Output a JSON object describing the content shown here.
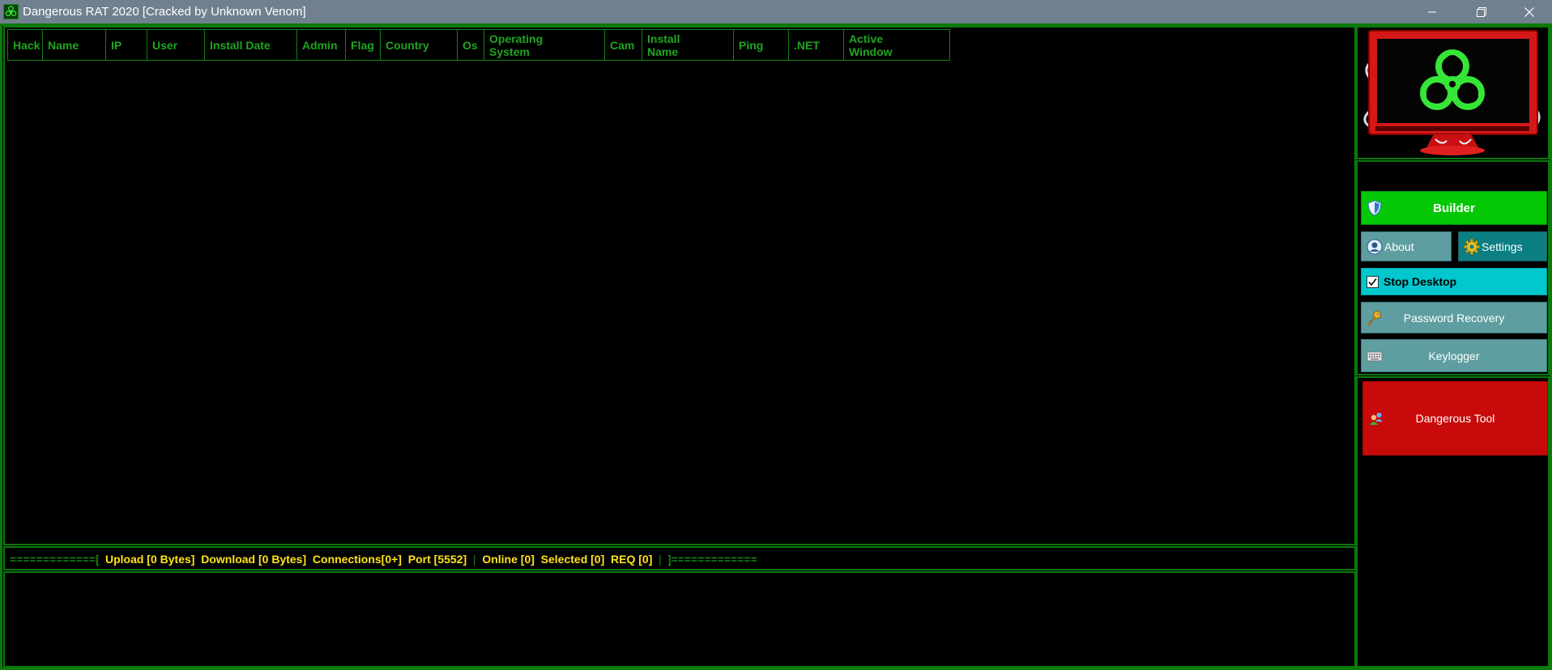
{
  "window": {
    "title": "Dangerous RAT 2020 [Cracked by Unknown Venom]"
  },
  "client_list": {
    "columns": [
      {
        "line1": "Hack",
        "line2": ""
      },
      {
        "line1": "Name",
        "line2": ""
      },
      {
        "line1": "IP",
        "line2": ""
      },
      {
        "line1": "User",
        "line2": ""
      },
      {
        "line1": "Install Date",
        "line2": ""
      },
      {
        "line1": "Admin",
        "line2": ""
      },
      {
        "line1": "Flag",
        "line2": ""
      },
      {
        "line1": "Country",
        "line2": ""
      },
      {
        "line1": "Os",
        "line2": ""
      },
      {
        "line1": "Operating",
        "line2": "System"
      },
      {
        "line1": "Cam",
        "line2": ""
      },
      {
        "line1": "Install",
        "line2": "Name"
      },
      {
        "line1": "Ping",
        "line2": ""
      },
      {
        "line1": ".NET",
        "line2": ""
      },
      {
        "line1": "Active",
        "line2": "Window"
      }
    ],
    "rows": []
  },
  "status_bar": {
    "left_rule": "=============",
    "open_bracket": "[",
    "upload": "Upload [0 Bytes]",
    "download": "Download [0 Bytes]",
    "connections": "Connections[0+]",
    "port": "Port [5552]",
    "sep1": "|",
    "online": "Online [0]",
    "selected": "Selected [0]",
    "req": "REQ [0]",
    "sep2": "|",
    "close_bracket": "]",
    "right_rule": "============="
  },
  "sidebar": {
    "builder_label": "Builder",
    "about_label": "About",
    "settings_label": "Settings",
    "stop_desktop_label": "Stop Desktop",
    "stop_desktop_checked": true,
    "password_recovery_label": "Password Recovery",
    "keylogger_label": "Keylogger",
    "dangerous_tool_label": "Dangerous Tool"
  },
  "icons": {
    "app": "biohazard-icon",
    "builder": "shield-icon",
    "about": "user-icon",
    "settings": "gear-icon",
    "password": "key-icon",
    "keylogger": "keyboard-icon",
    "dangerous_tool": "users-icon",
    "logo": "biohazard-monitor-logo"
  },
  "colors": {
    "frame_green": "#0a7a0a",
    "header_text": "#1fa51f",
    "status_yellow": "#ffe31a",
    "builder_green": "#05c805",
    "stop_cyan": "#00c8cd",
    "teal": "#5f9ea0",
    "danger_red": "#c80a0a"
  }
}
